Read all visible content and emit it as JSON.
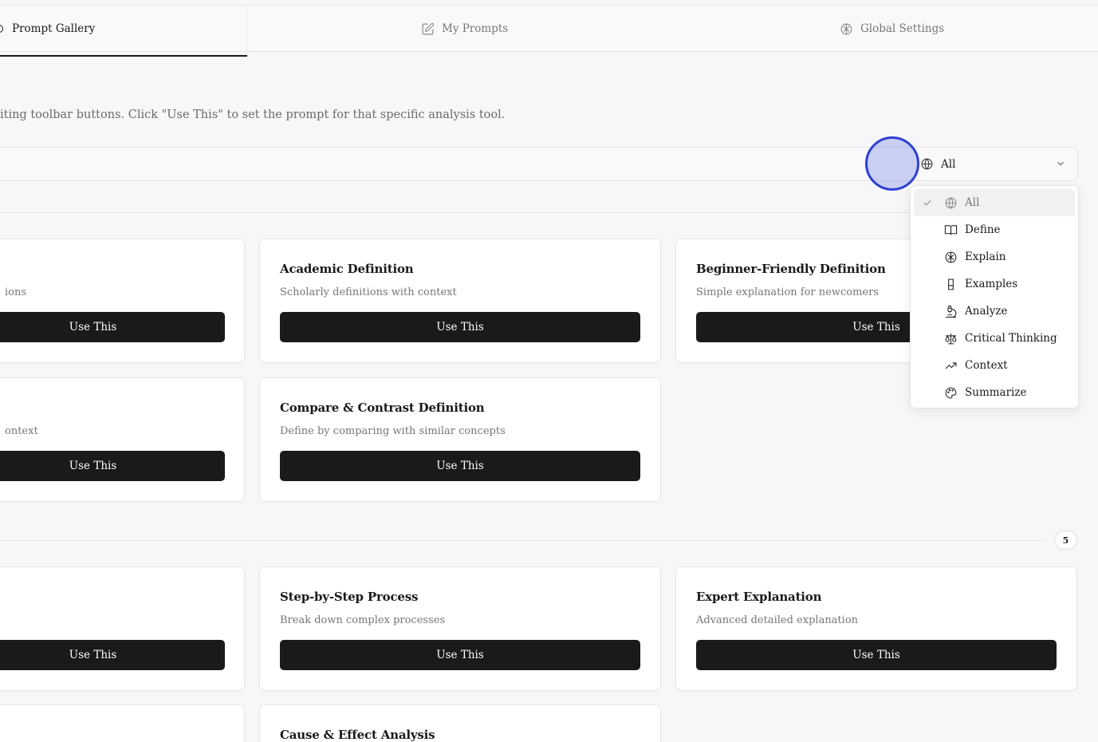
{
  "tabs": {
    "gallery": "Prompt Gallery",
    "my_prompts": "My Prompts",
    "global_settings": "Global Settings"
  },
  "description": "iting toolbar buttons. Click \"Use This\" to set the prompt for that specific analysis tool.",
  "filter": {
    "selected": "All",
    "options": [
      "All",
      "Define",
      "Explain",
      "Examples",
      "Analyze",
      "Critical Thinking",
      "Context",
      "Summarize"
    ]
  },
  "section_count": "5",
  "button_label": "Use This",
  "cards": [
    {
      "title": "",
      "desc": "ions"
    },
    {
      "title": "Academic Definition",
      "desc": "Scholarly definitions with context"
    },
    {
      "title": "Beginner-Friendly Definition",
      "desc": "Simple explanation for newcomers"
    },
    {
      "title": "",
      "desc": "ontext"
    },
    {
      "title": "Compare & Contrast Definition",
      "desc": "Define by comparing with similar concepts"
    },
    {
      "title": "",
      "desc": ""
    },
    {
      "title": "Step-by-Step Process",
      "desc": "Break down complex processes"
    },
    {
      "title": "Expert Explanation",
      "desc": "Advanced detailed explanation"
    },
    {
      "title": "Cause & Effect Analysis",
      "desc": ""
    }
  ]
}
